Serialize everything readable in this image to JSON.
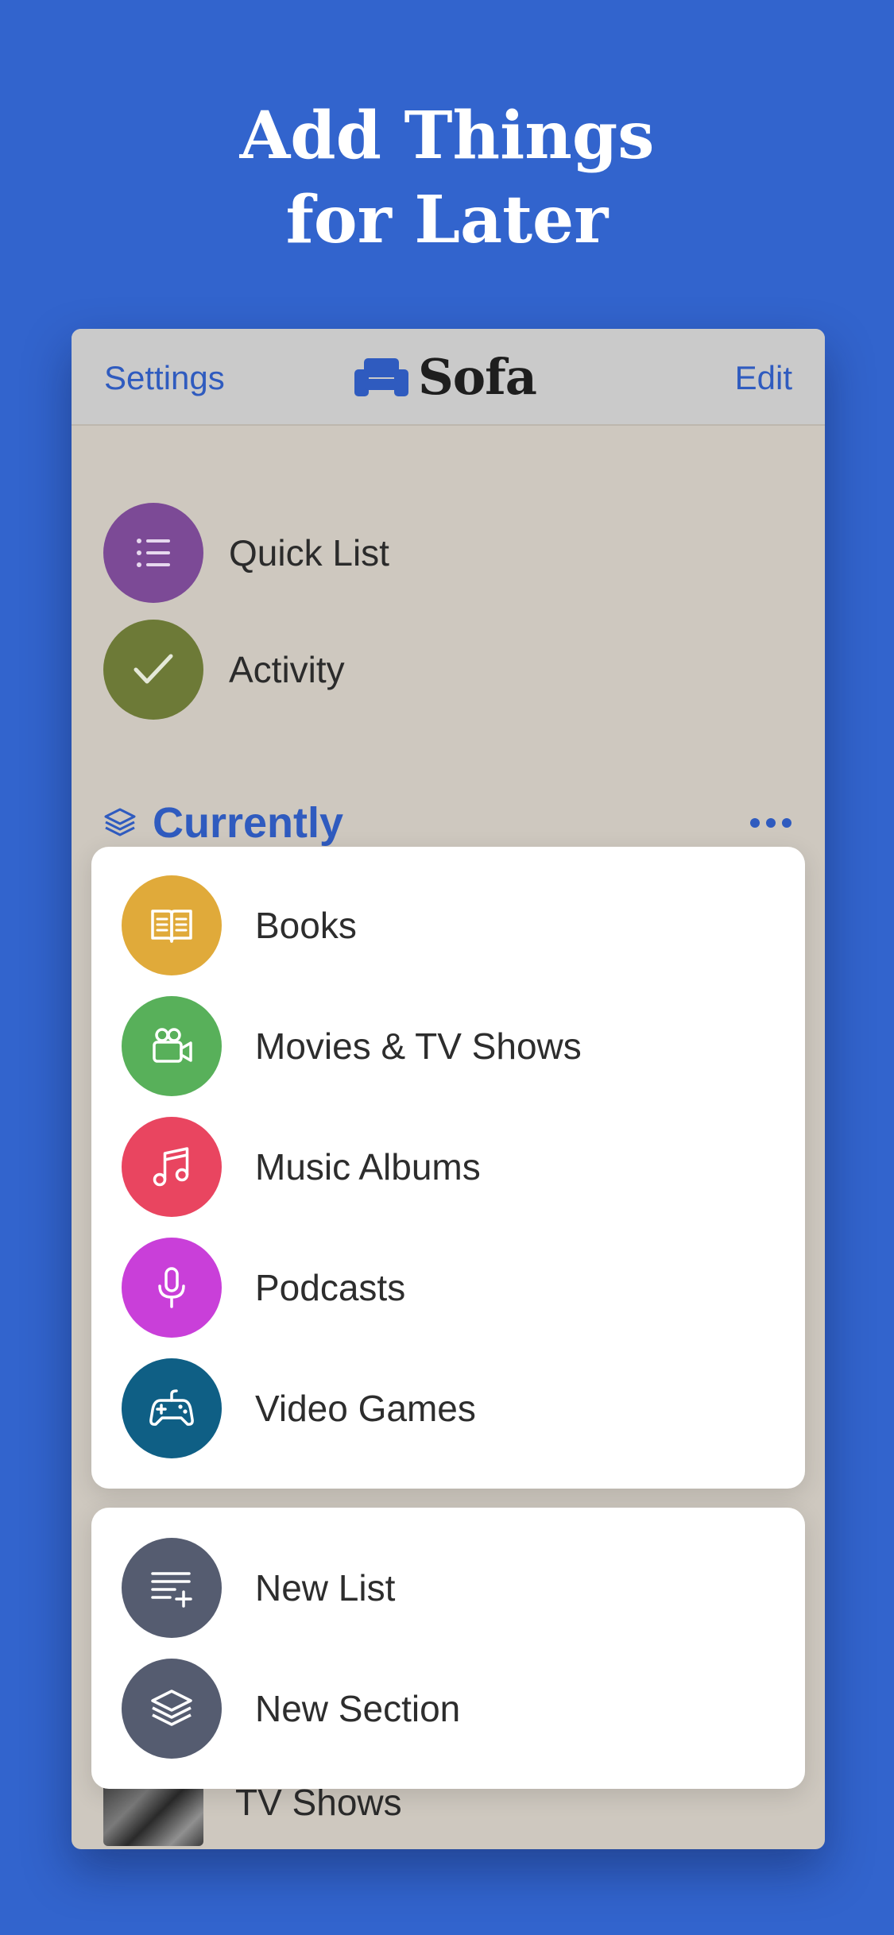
{
  "headline": {
    "line1": "Add Things",
    "line2": "for Later"
  },
  "nav": {
    "left": "Settings",
    "right": "Edit",
    "logo": "Sofa"
  },
  "lists": [
    {
      "label": "Quick List",
      "icon": "list-icon",
      "color": "#7c4a96"
    },
    {
      "label": "Activity",
      "icon": "checkmark-icon",
      "color": "#6d7a37"
    }
  ],
  "section": {
    "title": "Currently"
  },
  "peek": {
    "label": "TV Shows"
  },
  "add_menu": {
    "items": [
      {
        "label": "Books",
        "icon": "book-icon",
        "color": "#e0aa3a"
      },
      {
        "label": "Movies & TV Shows",
        "icon": "video-camera-icon",
        "color": "#58b05a"
      },
      {
        "label": "Music Albums",
        "icon": "music-note-icon",
        "color": "#e94560"
      },
      {
        "label": "Podcasts",
        "icon": "microphone-icon",
        "color": "#c93fd9"
      },
      {
        "label": "Video Games",
        "icon": "gamepad-icon",
        "color": "#0f5f85"
      }
    ],
    "create": [
      {
        "label": "New List",
        "icon": "new-list-icon",
        "color": "#555c70"
      },
      {
        "label": "New Section",
        "icon": "layers-icon",
        "color": "#555c70"
      }
    ]
  }
}
